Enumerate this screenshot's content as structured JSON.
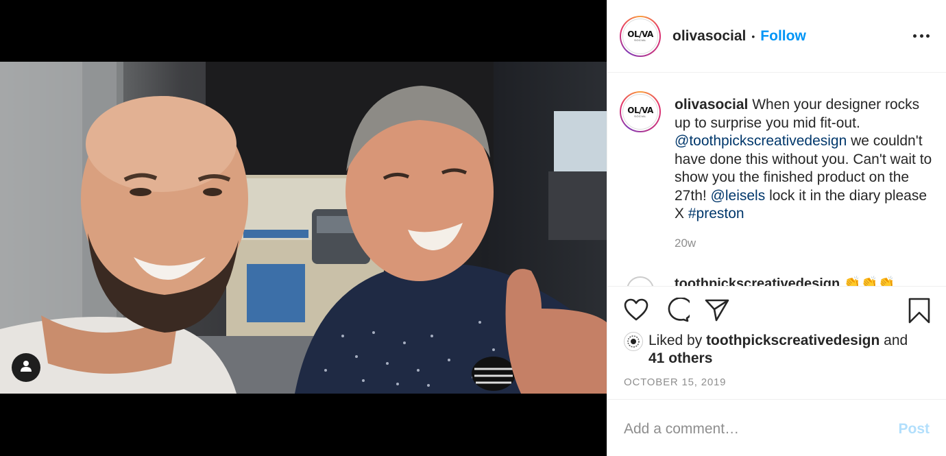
{
  "post": {
    "photo_alt": "",
    "user_tag_icon": "person-icon"
  },
  "header": {
    "avatar_logo_main": "OL/VA",
    "avatar_logo_sub": "SOCIAL",
    "username": "olivasocial",
    "separator": "•",
    "follow_label": "Follow",
    "more_icon": "ellipsis-icon"
  },
  "caption": {
    "username": "olivasocial",
    "text_1": " When your designer rocks up to surprise you mid fit-out. ",
    "mention_1": "@toothpickscreativedesign",
    "text_2": " we couldn't have done this without you. Can't wait to show you the finished product on the 27th! ",
    "mention_2": "@leisels",
    "text_3": " lock it in the diary please X ",
    "hashtag": "#preston",
    "time": "20w"
  },
  "next_comment": {
    "username_partial": "toothpickscreativedesign",
    "emoji": "👏👏👏"
  },
  "actions": {
    "like_icon": "heart-icon",
    "comment_icon": "comment-bubble-icon",
    "share_icon": "paper-plane-icon",
    "save_icon": "bookmark-icon"
  },
  "likes": {
    "prefix": "Liked by ",
    "user": "toothpickscreativedesign",
    "and": " and ",
    "others": "41 others"
  },
  "date": "OCTOBER 15, 2019",
  "comment": {
    "placeholder": "Add a comment…",
    "post_label": "Post"
  },
  "colors": {
    "follow_blue": "#0095f6",
    "link_blue": "#00376b",
    "post_disabled": "#b2dffc",
    "muted": "#8e8e8e"
  }
}
